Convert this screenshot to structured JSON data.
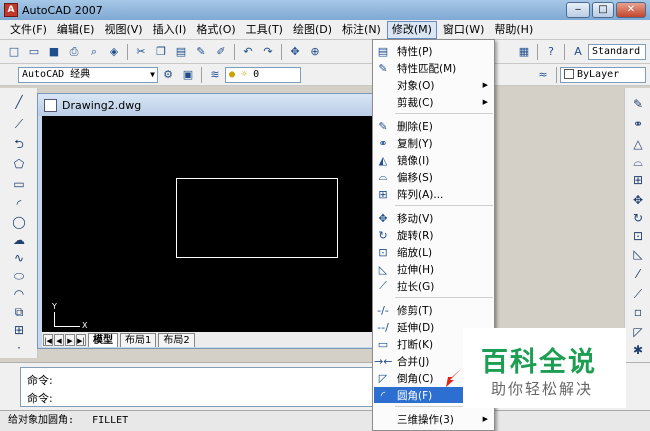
{
  "window": {
    "title": "AutoCAD 2007",
    "minimize": "‒",
    "maximize": "□",
    "close": "✕"
  },
  "menubar": {
    "items": [
      {
        "label": "文件(F)"
      },
      {
        "label": "编辑(E)"
      },
      {
        "label": "视图(V)"
      },
      {
        "label": "插入(I)"
      },
      {
        "label": "格式(O)"
      },
      {
        "label": "工具(T)"
      },
      {
        "label": "绘图(D)"
      },
      {
        "label": "标注(N)"
      },
      {
        "label": "修改(M)",
        "active": true
      },
      {
        "label": "窗口(W)"
      },
      {
        "label": "帮助(H)"
      }
    ]
  },
  "toolbar": {
    "text_style": "Standard",
    "workspace": "AutoCAD 经典",
    "layer_value": "0",
    "color_value": "ByLayer"
  },
  "drawing": {
    "title": "Drawing2.dwg",
    "ucs_x": "X",
    "ucs_y": "Y",
    "tabs": [
      "模型",
      "布局1",
      "布局2"
    ],
    "active_tab": "模型"
  },
  "command": {
    "line1": "命令:",
    "line2": "命令:"
  },
  "status": {
    "prompt": "给对象加圆角:",
    "command": "FILLET"
  },
  "modify_menu": {
    "items": [
      {
        "label": "特性(P)",
        "icon": "properties-icon"
      },
      {
        "label": "特性匹配(M)",
        "icon": "match-properties-icon"
      },
      {
        "label": "对象(O)",
        "submenu": true
      },
      {
        "label": "剪裁(C)",
        "submenu": true
      },
      {
        "label": "删除(E)",
        "icon": "erase-icon"
      },
      {
        "label": "复制(Y)",
        "icon": "copy-icon"
      },
      {
        "label": "镜像(I)",
        "icon": "mirror-icon"
      },
      {
        "label": "偏移(S)",
        "icon": "offset-icon"
      },
      {
        "label": "阵列(A)...",
        "icon": "array-icon"
      },
      {
        "label": "移动(V)",
        "icon": "move-icon"
      },
      {
        "label": "旋转(R)",
        "icon": "rotate-icon"
      },
      {
        "label": "缩放(L)",
        "icon": "scale-icon"
      },
      {
        "label": "拉伸(H)",
        "icon": "stretch-icon"
      },
      {
        "label": "拉长(G)",
        "icon": "lengthen-icon"
      },
      {
        "label": "修剪(T)",
        "icon": "trim-icon"
      },
      {
        "label": "延伸(D)",
        "icon": "extend-icon"
      },
      {
        "label": "打断(K)",
        "icon": "break-icon"
      },
      {
        "label": "合并(J)",
        "icon": "join-icon"
      },
      {
        "label": "倒角(C)",
        "icon": "chamfer-icon"
      },
      {
        "label": "圆角(F)",
        "icon": "fillet-icon",
        "highlighted": true
      },
      {
        "label": "三维操作(3)",
        "submenu": true
      }
    ]
  },
  "watermark": {
    "title": "百科全说",
    "subtitle": "助你轻松解决"
  },
  "colors": {
    "highlight": "#2c6fd1",
    "brand_green": "#1d9e53",
    "canvas": "#000000"
  }
}
